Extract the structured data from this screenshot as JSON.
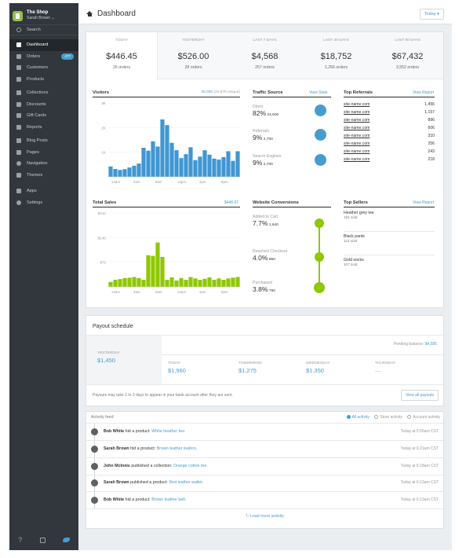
{
  "sidebar": {
    "shop_name": "The Shop",
    "user": "Sarah Brown ⌄",
    "search": "Search",
    "items": [
      {
        "label": "Dashboard",
        "icon": "home-icon",
        "active": true
      },
      {
        "label": "Orders",
        "icon": "orders-icon",
        "badge": "477"
      },
      {
        "label": "Customers",
        "icon": "customers-icon"
      },
      {
        "label": "Products",
        "icon": "products-icon"
      },
      {
        "label": "Collections",
        "icon": "collections-icon"
      },
      {
        "label": "Discounts",
        "icon": "discounts-icon"
      },
      {
        "label": "Gift Cards",
        "icon": "gift-card-icon"
      },
      {
        "label": "Reports",
        "icon": "reports-icon"
      },
      {
        "label": "Blog Posts",
        "icon": "blog-icon"
      },
      {
        "label": "Pages",
        "icon": "pages-icon"
      },
      {
        "label": "Navigation",
        "icon": "navigation-icon"
      },
      {
        "label": "Themes",
        "icon": "themes-icon"
      },
      {
        "label": "Apps",
        "icon": "apps-icon"
      },
      {
        "label": "Settings",
        "icon": "settings-icon"
      }
    ],
    "bottom": {
      "help": "?"
    }
  },
  "header": {
    "title": "Dashboard",
    "date_button": "Today ▾"
  },
  "stats": [
    {
      "label": "TODAY",
      "value": "$446.45",
      "orders": "26 orders"
    },
    {
      "label": "YESTERDAY",
      "value": "$526.00",
      "orders": "28 orders"
    },
    {
      "label": "LAST 7 DAYS",
      "value": "$4,568",
      "orders": "257 orders"
    },
    {
      "label": "LAST 30 DAYS",
      "value": "$18,752",
      "orders": "1,256 orders"
    },
    {
      "label": "LAST 90 DAYS",
      "value": "$67,432",
      "orders": "3,552 orders"
    }
  ],
  "visitors": {
    "title": "Visitors",
    "summary": "30,000",
    "summary_unique": "(24,675 unique)"
  },
  "traffic": {
    "title": "Traffic Source",
    "link": "View Stats",
    "rows": [
      {
        "label": "Direct",
        "pct": "82%",
        "count": "24,600",
        "icon": "direct-icon"
      },
      {
        "label": "Referrals",
        "pct": "9%",
        "count": "2,700",
        "icon": "link-icon"
      },
      {
        "label": "Search Engines",
        "pct": "9%",
        "count": "2,700",
        "icon": "search-icon"
      }
    ]
  },
  "referrals": {
    "title": "Top Referrals",
    "link": "View Report",
    "rows": [
      {
        "site": "site-name.com",
        "count": "1,456"
      },
      {
        "site": "site-name.com",
        "count": "1,157"
      },
      {
        "site": "site-name.com",
        "count": "896"
      },
      {
        "site": "site-name.com",
        "count": "606"
      },
      {
        "site": "site-name.com",
        "count": "310"
      },
      {
        "site": "site-name.com",
        "count": "256"
      },
      {
        "site": "site-name.com",
        "count": "243"
      },
      {
        "site": "site-name.com",
        "count": "218"
      }
    ]
  },
  "sales": {
    "title": "Total Sales",
    "total": "$446.67"
  },
  "conversions": {
    "title": "Website Conversions",
    "rows": [
      {
        "label": "Added to Cart",
        "pct": "7.7%",
        "count": "1,640",
        "icon": "cart-icon"
      },
      {
        "label": "Reached Checkout",
        "pct": "4.0%",
        "count": "850",
        "icon": "checkout-icon"
      },
      {
        "label": "Purchased",
        "pct": "3.8%",
        "count": "790",
        "icon": "purchased-icon"
      }
    ]
  },
  "sellers": {
    "title": "Top Sellers",
    "link": "View Report",
    "rows": [
      {
        "name": "Heather grey tee",
        "sold": "191 sold"
      },
      {
        "name": "Black pants",
        "sold": "113 sold"
      },
      {
        "name": "Gold socks",
        "sold": "107 sold"
      }
    ]
  },
  "payout": {
    "title": "Payout schedule",
    "pending_label": "Pending balance:",
    "pending_value": "$4,585",
    "days": [
      {
        "label": "YESTERDAY",
        "value": "$1,450"
      },
      {
        "label": "TODAY",
        "value": "$1,960"
      },
      {
        "label": "TOMORROW",
        "value": "$1,275"
      },
      {
        "label": "WEDNESDAY",
        "value": "$1,350"
      },
      {
        "label": "THURSDAY",
        "value": "—"
      }
    ],
    "note": "Payouts may take 1 to 2 days to appear in your bank account after they are sent.",
    "button": "View all payouts"
  },
  "activity": {
    "title": "Activity feed",
    "filters": [
      "All activity",
      "Store activity",
      "Account activity"
    ],
    "rows": [
      {
        "user": "Bob White",
        "action": " hid a product: ",
        "target": "White heather tee.",
        "time": "Today at 6:55am CST"
      },
      {
        "user": "Sarah Brown",
        "action": " hid a product: ",
        "target": "Brown leather loafers.",
        "time": "Today at 6:21am CST"
      },
      {
        "user": "John McInnis",
        "action": " published a collection: ",
        "target": "Orange cotton tee.",
        "time": "Today at 6:18am CST"
      },
      {
        "user": "Sarah Brown",
        "action": " published a product: ",
        "target": "Red leather wallet.",
        "time": "Today at 6:13am CST"
      },
      {
        "user": "Bob White",
        "action": " hid a product: ",
        "target": "Brown leather belt.",
        "time": "Today at 6:13am CST"
      }
    ],
    "load_more": "Load more activity"
  },
  "chart_data": [
    {
      "type": "bar",
      "title": "Visitors",
      "color": "#3f97d3",
      "ylim": [
        0,
        3000
      ],
      "yticks": [
        "3K",
        "2K",
        "1K"
      ],
      "xticks": [
        "12am",
        "4am",
        "8am",
        "12pm",
        "4pm",
        "8pm"
      ],
      "values": [
        420,
        320,
        280,
        310,
        380,
        450,
        540,
        1180,
        1060,
        1440,
        1230,
        2330,
        2100,
        1380,
        1080,
        760,
        920,
        1200,
        680,
        820,
        1080,
        900,
        740,
        700,
        800,
        1040,
        650,
        1040
      ]
    },
    {
      "type": "bar",
      "title": "Total Sales",
      "color": "#8fc800",
      "ylim": [
        0,
        210
      ],
      "yticks": [
        "$210",
        "$140",
        "$70"
      ],
      "xticks": [
        "12am",
        "4am",
        "8am",
        "12pm",
        "4pm",
        "8pm"
      ],
      "values": [
        14,
        20,
        22,
        25,
        26,
        28,
        25,
        20,
        90,
        88,
        126,
        85,
        20,
        27,
        18,
        25,
        20,
        28,
        24,
        20,
        23,
        27,
        20,
        24,
        20,
        24,
        26,
        28
      ]
    }
  ]
}
